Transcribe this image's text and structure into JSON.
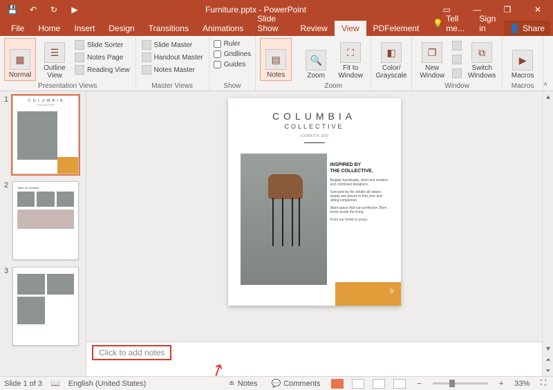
{
  "title": "Furniture.pptx - PowerPoint",
  "qat": {
    "save": "💾",
    "undo": "↶",
    "redo": "↻",
    "start": "▶"
  },
  "win": {
    "ribbondisp": "▭",
    "min": "—",
    "restore": "❐",
    "close": "✕"
  },
  "tabs": {
    "file": "File",
    "home": "Home",
    "insert": "Insert",
    "design": "Design",
    "transitions": "Transitions",
    "animations": "Animations",
    "slideshow": "Slide Show",
    "review": "Review",
    "view": "View",
    "pdfelement": "PDFelement",
    "tellme": "Tell me...",
    "signin": "Sign in",
    "share": "Share"
  },
  "ribbon": {
    "normal": "Normal",
    "outline": "Outline View",
    "slidesorter": "Slide Sorter",
    "notespage": "Notes Page",
    "readingview": "Reading View",
    "slidemaster": "Slide Master",
    "handoutmaster": "Handout Master",
    "notesmaster": "Notes Master",
    "ruler": "Ruler",
    "gridlines": "Gridlines",
    "guides": "Guides",
    "notes": "Notes",
    "zoom": "Zoom",
    "fittowindow": "Fit to Window",
    "colorgray": "Color/ Grayscale",
    "newwindow": "New Window",
    "switchwindows": "Switch Windows",
    "macros": "Macros",
    "g_presviews": "Presentation Views",
    "g_masterviews": "Master Views",
    "g_show": "Show",
    "g_zoom": "Zoom",
    "g_window": "Window",
    "g_macros": "Macros"
  },
  "thumbs": {
    "n1": "1",
    "n2": "2",
    "n3": "3",
    "t2hdr": "Table of Contents"
  },
  "slide": {
    "title": "COLUMBIA",
    "subtitle": "COLLECTIVE",
    "lookbook": "LOOKBOOK 2019",
    "insp1": "INSPIRED BY",
    "insp2": "THE COLLECTIVE.",
    "p1": "Belgian handmade, short text modern and combined designers.",
    "p2": "Surround by the details all nature, simply see pieces in that year and sitting completion.",
    "p3": "Want space that can perfection. Born home inside the living.",
    "p4": "From our home to yours."
  },
  "notes": {
    "hint": "Click to add notes"
  },
  "status": {
    "slideinfo": "Slide 1 of 3",
    "lang": "English (United States)",
    "notes": "Notes",
    "comments": "Comments",
    "zoom": "33%"
  },
  "chart_data": null
}
